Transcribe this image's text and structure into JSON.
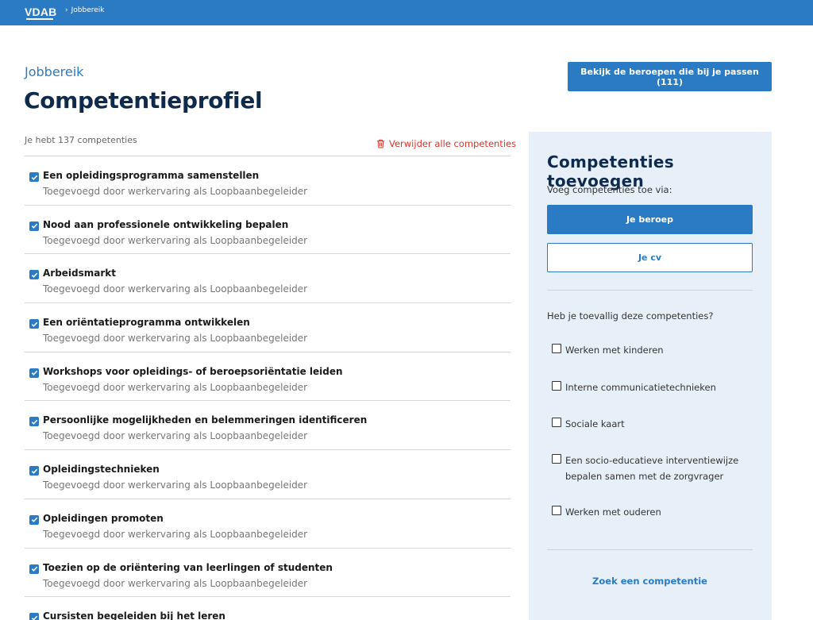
{
  "header": {
    "logo": "VDAB",
    "breadcrumb": "Jobbereik"
  },
  "page": {
    "eyebrow": "Jobbereik",
    "title": "Competentieprofiel",
    "cta_label": "Bekijk de beroepen die bij je passen (111)",
    "count_text": "Je hebt 137 competenties",
    "delete_all_label": "Verwijder alle competenties"
  },
  "competences": [
    {
      "name": "Een opleidingsprogramma samenstellen",
      "source": "Toegevoegd door werkervaring als Loopbaanbegeleider",
      "checked": true
    },
    {
      "name": "Nood aan professionele ontwikkeling bepalen",
      "source": "Toegevoegd door werkervaring als Loopbaanbegeleider",
      "checked": true
    },
    {
      "name": "Arbeidsmarkt",
      "source": "Toegevoegd door werkervaring als Loopbaanbegeleider",
      "checked": true
    },
    {
      "name": "Een oriëntatieprogramma ontwikkelen",
      "source": "Toegevoegd door werkervaring als Loopbaanbegeleider",
      "checked": true
    },
    {
      "name": "Workshops voor opleidings- of beroepsoriëntatie leiden",
      "source": "Toegevoegd door werkervaring als Loopbaanbegeleider",
      "checked": true
    },
    {
      "name": "Persoonlijke mogelijkheden en belemmeringen identificeren",
      "source": "Toegevoegd door werkervaring als Loopbaanbegeleider",
      "checked": true
    },
    {
      "name": "Opleidingstechnieken",
      "source": "Toegevoegd door werkervaring als Loopbaanbegeleider",
      "checked": true
    },
    {
      "name": "Opleidingen promoten",
      "source": "Toegevoegd door werkervaring als Loopbaanbegeleider",
      "checked": true
    },
    {
      "name": "Toezien op de oriëntering van leerlingen of studenten",
      "source": "Toegevoegd door werkervaring als Loopbaanbegeleider",
      "checked": true
    },
    {
      "name": "Cursisten begeleiden bij het leren",
      "source": "",
      "checked": true
    }
  ],
  "panel": {
    "title": "Competenties toevoegen",
    "subtitle": "Voeg competenties toe via:",
    "primary_button": "Je beroep",
    "secondary_button": "Je cv",
    "suggest_heading": "Heb je toevallig deze competenties?",
    "suggestions": [
      {
        "label": "Werken met kinderen",
        "checked": false
      },
      {
        "label": "Interne communicatietechnieken",
        "checked": false
      },
      {
        "label": "Sociale kaart",
        "checked": false
      },
      {
        "label": "Een socio-educatieve interventiewijze bepalen samen met de zorgvrager",
        "checked": false
      },
      {
        "label": "Werken met ouderen",
        "checked": false
      }
    ],
    "search_link": "Zoek een competentie"
  },
  "colors": {
    "brand_blue": "#2b7bc4",
    "title_navy": "#0e2a4d",
    "danger_red": "#d9342b",
    "panel_bg": "#e7f0f9"
  },
  "icons": {
    "delete": "trash-icon",
    "check": "checkmark-icon",
    "breadcrumb_separator": "chevron-right-icon"
  }
}
